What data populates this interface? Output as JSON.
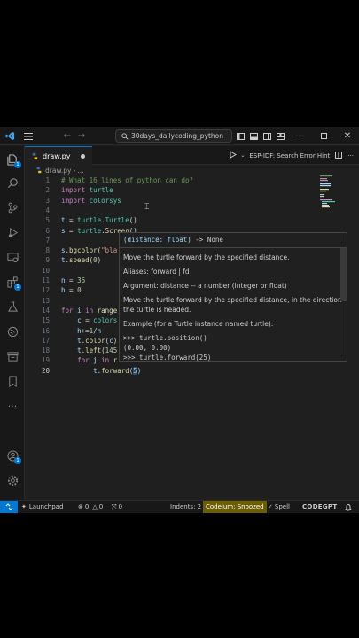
{
  "titlebar": {
    "search_text": "30days_dailycoding_python"
  },
  "tabs": [
    {
      "label": "draw.py",
      "modified": true
    }
  ],
  "tab_actions": {
    "espidf_label": "ESP-IDF: Search Error Hint"
  },
  "breadcrumb": {
    "file": "draw.py",
    "more": "..."
  },
  "editor": {
    "line_numbers": [
      "1",
      "2",
      "3",
      "4",
      "5",
      "6",
      "7",
      "8",
      "9",
      "10",
      "11",
      "12",
      "13",
      "14",
      "15",
      "16",
      "17",
      "18",
      "19",
      "20"
    ],
    "active_line": "20"
  },
  "hover": {
    "signature_param": "(distance: float)",
    "signature_return": " -> None",
    "description": "Move the turtle forward by the specified distance.",
    "aliases": "Aliases: forward | fd",
    "argument": "Argument: distance -- a number (integer or float)",
    "detail": "Move the turtle forward by the specified distance, in the direction the turtle is headed.",
    "example_heading": "Example (for a Turtle instance named turtle):",
    "example_line1": ">>> turtle.position()",
    "example_line2": "(0.00, 0.00)",
    "example_line3": ">>> turtle.forward(25)"
  },
  "statusbar": {
    "launchpad": "Launchpad",
    "errors": "0",
    "warnings": "0",
    "ports": "0",
    "indents": "Indents: 2",
    "codeium": "Codeium: Snoozed",
    "spell": "Spell",
    "codegpt": "CODEGPT"
  },
  "colors": {
    "accent": "#0078d4",
    "editor_bg": "#1f1f1f",
    "chrome_bg": "#181818",
    "codeium_bg": "#6b5e00"
  }
}
